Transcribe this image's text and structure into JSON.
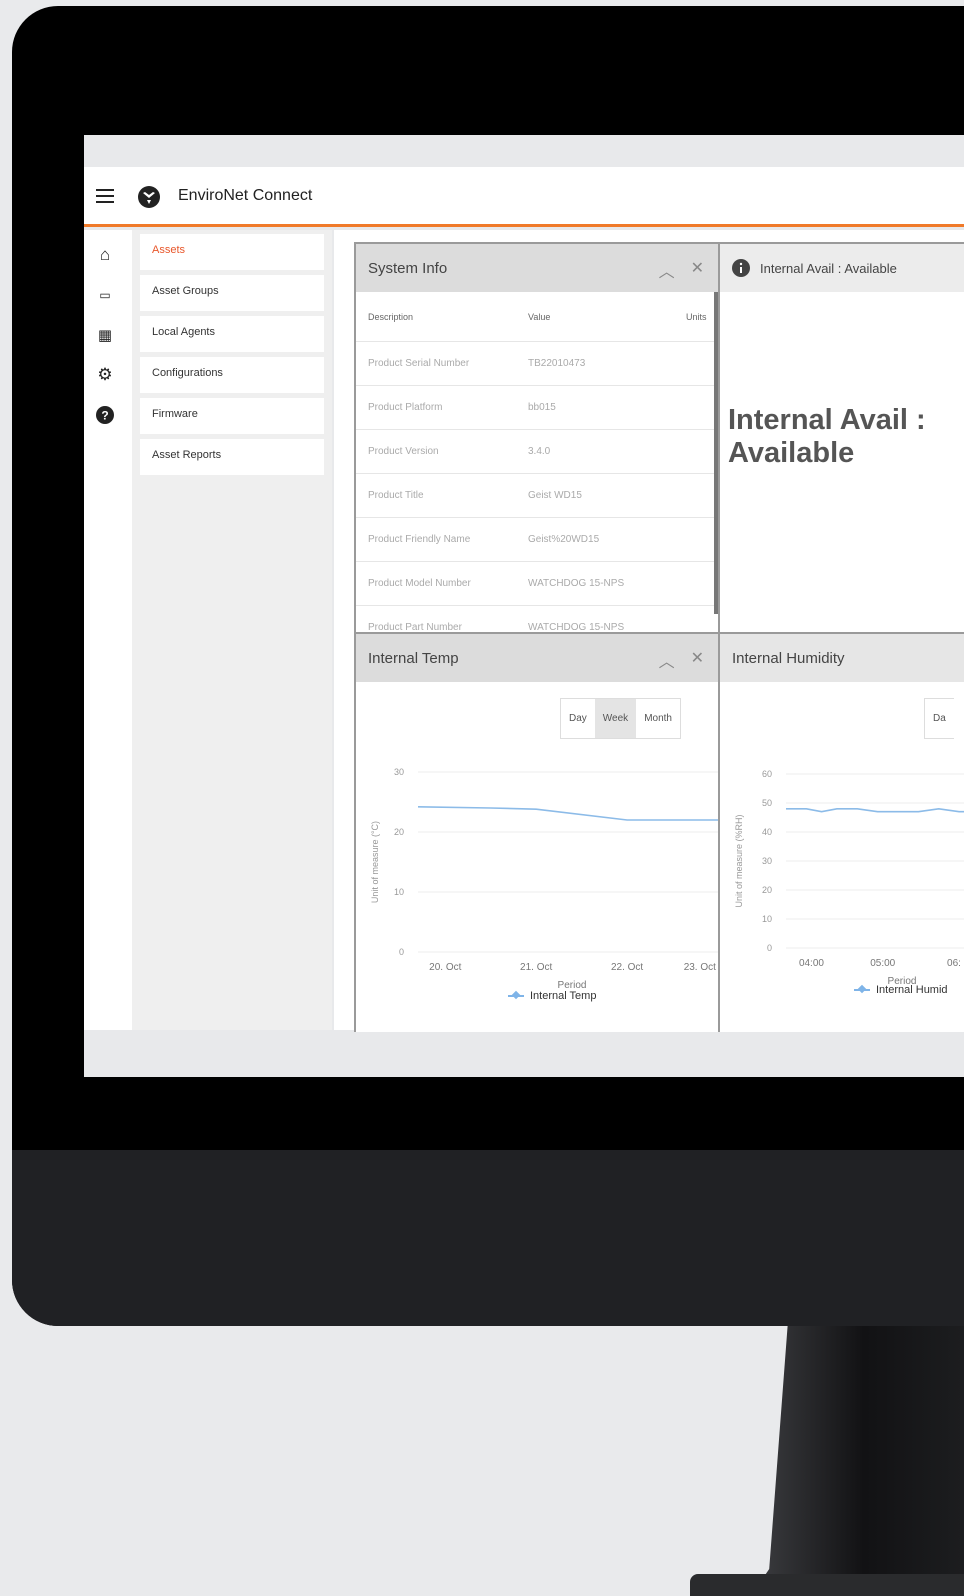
{
  "app": {
    "title": "EnviroNet Connect"
  },
  "sidebar": {
    "items": [
      {
        "label": "Assets",
        "active": true
      },
      {
        "label": "Asset Groups"
      },
      {
        "label": "Local Agents"
      },
      {
        "label": "Configurations"
      },
      {
        "label": "Firmware"
      },
      {
        "label": "Asset Reports"
      }
    ],
    "rail_icons": [
      "home-icon",
      "assets-icon",
      "dashboard-icon",
      "settings-icon",
      "help-icon"
    ]
  },
  "system_info": {
    "title": "System Info",
    "columns": [
      "Description",
      "Value",
      "Units"
    ],
    "rows": [
      [
        "Product Serial Number",
        "TB22010473",
        ""
      ],
      [
        "Product Platform",
        "bb015",
        ""
      ],
      [
        "Product Version",
        "3.4.0",
        ""
      ],
      [
        "Product Title",
        "Geist WD15",
        ""
      ],
      [
        "Product Friendly Name",
        "Geist%20WD15",
        ""
      ],
      [
        "Product Model Number",
        "WATCHDOG 15-NPS",
        ""
      ],
      [
        "Product Part Number",
        "WATCHDOG 15-NPS",
        ""
      ]
    ]
  },
  "avail": {
    "header": "Internal Avail : Available",
    "big_line1": "Internal Avail :",
    "big_line2": "Available"
  },
  "temp": {
    "title": "Internal Temp",
    "range": [
      "Day",
      "Week",
      "Month"
    ],
    "selected": "Week",
    "chart_data": {
      "type": "line",
      "xlabel": "Period",
      "ylabel": "Unit of measure (°C)",
      "ylim": [
        0,
        30
      ],
      "yticks": [
        "0",
        "10",
        "20",
        "30"
      ],
      "xticks": [
        "20. Oct",
        "21. Oct",
        "22. Oct",
        "23. Oct"
      ],
      "series": [
        {
          "name": "Internal Temp",
          "x": [
            19.7,
            20.5,
            21.0,
            22.0,
            23.0
          ],
          "values": [
            24.2,
            24.0,
            23.8,
            22.0,
            22.0
          ]
        }
      ]
    }
  },
  "humidity": {
    "title": "Internal Humidity",
    "range_first": "Da",
    "chart_data": {
      "type": "line",
      "xlabel": "Period",
      "ylabel": "Unit of measure (%RH)",
      "ylim": [
        0,
        60
      ],
      "yticks": [
        "0",
        "10",
        "20",
        "30",
        "40",
        "50",
        "60"
      ],
      "xticks": [
        "04:00",
        "05:00",
        "06:"
      ],
      "series": [
        {
          "name": "Internal Humid",
          "x": [
            3.6,
            3.8,
            3.95,
            4.1,
            4.3,
            4.5,
            4.7,
            4.9,
            5.1,
            5.3,
            5.5,
            5.8
          ],
          "values": [
            48,
            48,
            47,
            48,
            48,
            47,
            47,
            47,
            48,
            47,
            47,
            47
          ]
        }
      ]
    }
  }
}
